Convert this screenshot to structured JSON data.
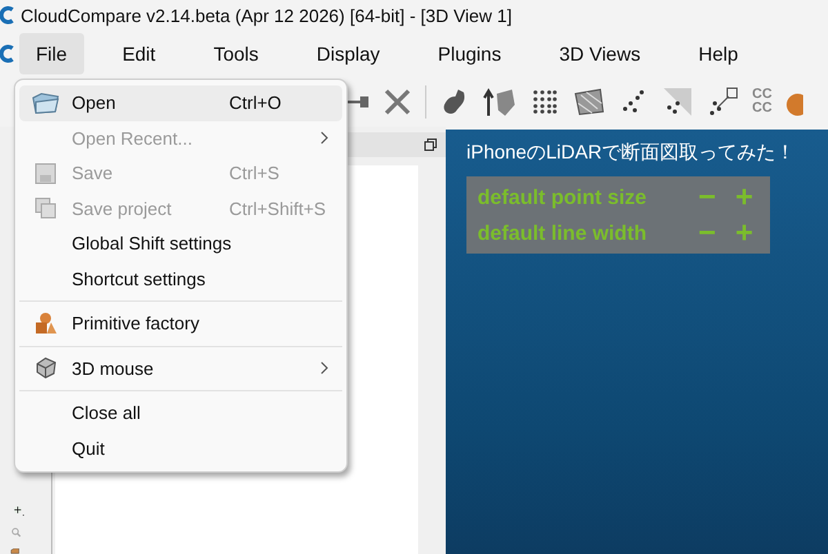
{
  "window": {
    "title": "CloudCompare v2.14.beta (Apr 12 2026) [64-bit] - [3D View 1]"
  },
  "menu_bar": [
    {
      "label": "File",
      "selected": true
    },
    {
      "label": "Edit",
      "selected": false
    },
    {
      "label": "Tools",
      "selected": false
    },
    {
      "label": "Display",
      "selected": false
    },
    {
      "label": "Plugins",
      "selected": false
    },
    {
      "label": "3D Views",
      "selected": false
    },
    {
      "label": "Help",
      "selected": false
    }
  ],
  "toolbar": {
    "cc_icon_lines": [
      "CC",
      "CC"
    ]
  },
  "file_menu": {
    "groups": [
      [
        {
          "label": "Open",
          "shortcut": "Ctrl+O",
          "disabled": false,
          "selected": true,
          "submenu": false
        },
        {
          "label": "Open Recent...",
          "disabled": true,
          "selected": false,
          "submenu": true
        },
        {
          "label": "Save",
          "shortcut": "Ctrl+S",
          "disabled": true,
          "selected": false,
          "submenu": false
        },
        {
          "label": "Save project",
          "shortcut": "Ctrl+Shift+S",
          "disabled": true,
          "selected": false,
          "submenu": false
        },
        {
          "label": "Global Shift settings",
          "disabled": false,
          "selected": false,
          "submenu": false
        },
        {
          "label": "Shortcut settings",
          "disabled": false,
          "selected": false,
          "submenu": false
        }
      ],
      [
        {
          "label": "Primitive factory",
          "disabled": false,
          "selected": false,
          "submenu": false
        }
      ],
      [
        {
          "label": "3D mouse",
          "disabled": false,
          "selected": false,
          "submenu": true
        }
      ],
      [
        {
          "label": "Close all",
          "disabled": false,
          "selected": false,
          "submenu": false
        },
        {
          "label": "Quit",
          "disabled": false,
          "selected": false,
          "submenu": false
        }
      ]
    ]
  },
  "view": {
    "title": "iPhoneのLiDARで断面図取ってみた！",
    "controls": [
      {
        "label": "default point size",
        "minus": "−",
        "plus": "+"
      },
      {
        "label": "default line width",
        "minus": "−",
        "plus": "+"
      }
    ]
  }
}
